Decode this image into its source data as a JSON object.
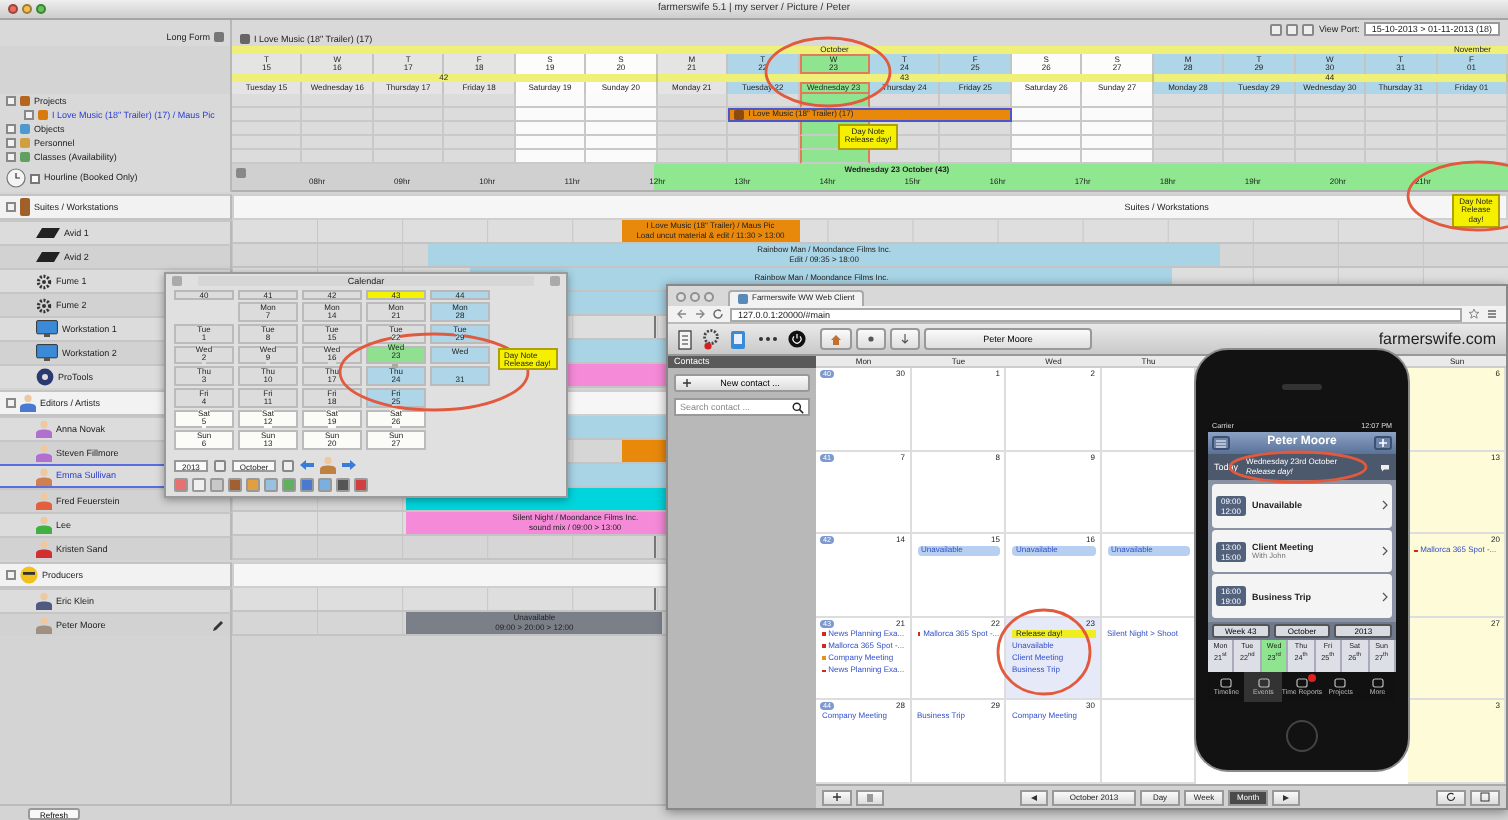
{
  "window": {
    "title": "farmerswife 5.1  |  my server / Picture / Peter"
  },
  "viewport": {
    "label": "View Port:",
    "value": "15-10-2013 > 01-11-2013 (18)"
  },
  "sidebar": {
    "long_form": "Long Form",
    "tree": [
      {
        "label": "Projects",
        "kind": "folder",
        "children": [
          {
            "label": "I Love Music (18\" Trailer) (17) / Maus Pic",
            "kind": "project"
          }
        ]
      },
      {
        "label": "Objects",
        "kind": "objects"
      },
      {
        "label": "Personnel",
        "kind": "personnel"
      },
      {
        "label": "Classes (Availability)",
        "kind": "classes"
      }
    ]
  },
  "timeline": {
    "project": "I Love Music (18\" Trailer) (17)",
    "project_bar": "I Love Music (18\" Trailer) (17)",
    "weeks": [
      {
        "label": "42",
        "days": [
          {
            "letter": "T",
            "num": "15",
            "name": "Tuesday 15",
            "kind": "weekday",
            "selected": false,
            "booked": false
          },
          {
            "letter": "W",
            "num": "16",
            "name": "Wednesday 16",
            "kind": "weekday",
            "selected": false,
            "booked": false
          },
          {
            "letter": "T",
            "num": "17",
            "name": "Thursday 17",
            "kind": "weekday",
            "selected": false,
            "booked": false
          },
          {
            "letter": "F",
            "num": "18",
            "name": "Friday 18",
            "kind": "weekday",
            "selected": false,
            "booked": false
          },
          {
            "letter": "S",
            "num": "19",
            "name": "Saturday 19",
            "kind": "weekend",
            "selected": false,
            "booked": false
          },
          {
            "letter": "S",
            "num": "20",
            "name": "Sunday 20",
            "kind": "weekend",
            "selected": false,
            "booked": false
          }
        ]
      },
      {
        "label": "43",
        "days": [
          {
            "letter": "M",
            "num": "21",
            "name": "Monday 21",
            "kind": "weekday",
            "selected": false,
            "booked": false
          },
          {
            "letter": "T",
            "num": "22",
            "name": "Tuesday 22",
            "kind": "current",
            "selected": false,
            "booked": true
          },
          {
            "letter": "W",
            "num": "23",
            "name": "Wednesday 23",
            "kind": "current",
            "selected": true,
            "booked": true,
            "month": "October",
            "note": {
              "title": "Day Note",
              "text": "Release day!"
            }
          },
          {
            "letter": "T",
            "num": "24",
            "name": "Thursday 24",
            "kind": "current",
            "selected": false,
            "booked": true
          },
          {
            "letter": "F",
            "num": "25",
            "name": "Friday 25",
            "kind": "current",
            "selected": false,
            "booked": true
          },
          {
            "letter": "S",
            "num": "26",
            "name": "Saturday 26",
            "kind": "weekend",
            "selected": false,
            "booked": false
          },
          {
            "letter": "S",
            "num": "27",
            "name": "Sunday 27",
            "kind": "weekend",
            "selected": false,
            "booked": false
          }
        ]
      },
      {
        "label": "44",
        "days": [
          {
            "letter": "M",
            "num": "28",
            "name": "Monday 28",
            "kind": "current",
            "selected": false,
            "booked": false
          },
          {
            "letter": "T",
            "num": "29",
            "name": "Tuesday 29",
            "kind": "current",
            "selected": false,
            "booked": false
          },
          {
            "letter": "W",
            "num": "30",
            "name": "Wednesday 30",
            "kind": "current",
            "selected": false,
            "booked": false
          },
          {
            "letter": "T",
            "num": "31",
            "name": "Thursday 31",
            "kind": "current",
            "selected": false,
            "booked": false
          },
          {
            "letter": "F",
            "num": "01",
            "name": "Friday 01",
            "kind": "current",
            "selected": false,
            "booked": false,
            "month": "November"
          }
        ]
      }
    ]
  },
  "hourline": {
    "label": "Hourline (Booked Only)",
    "checked": false,
    "day_title": "Wednesday 23 October (43)",
    "hours": [
      "08hr",
      "09hr",
      "10hr",
      "11hr",
      "12hr",
      "13hr",
      "14hr",
      "15hr",
      "16hr",
      "17hr",
      "18hr",
      "19hr",
      "20hr",
      "21hr"
    ]
  },
  "resources": [
    {
      "name": "Suites / Workstations",
      "kind": "room",
      "track_label": "Suites / Workstations",
      "note": {
        "title": "Day Note",
        "text": "Release day!"
      },
      "items": [
        {
          "name": "Avid 1",
          "kind": "device",
          "selected": false,
          "bookings": [
            {
              "title": "I Love Music (18\" Trailer) / Maus Pic",
              "detail": "Load uncut material & edit / 11:30 > 13:00",
              "color": "#e8890c"
            }
          ]
        },
        {
          "name": "Avid 2",
          "kind": "device",
          "selected": false,
          "bookings": [
            {
              "title": "Rainbow Man / Moondance Films Inc.",
              "detail": "Edit / 09:35 > 18:00",
              "color": "#a8d4e6"
            }
          ]
        },
        {
          "name": "Fume 1",
          "kind": "gear",
          "selected": false,
          "bookings": [
            {
              "title": "Rainbow Man / Moondance Films Inc.",
              "color": "#a8d4e6"
            }
          ]
        },
        {
          "name": "Fume 2",
          "kind": "gear",
          "selected": false,
          "bookings": [
            {
              "color": "#a8d4e6"
            }
          ]
        },
        {
          "name": "Workstation 1",
          "kind": "monitor",
          "selected": false
        },
        {
          "name": "Workstation 2",
          "kind": "monitor",
          "selected": false,
          "bookings": [
            {
              "color": "#a8d4e6"
            }
          ]
        },
        {
          "name": "ProTools",
          "kind": "disc",
          "selected": false,
          "bookings": [
            {
              "color": "#f58ad8"
            }
          ]
        }
      ]
    },
    {
      "name": "Editors / Artists",
      "kind": "person",
      "items": [
        {
          "name": "Anna Novak",
          "kind": "person",
          "color": "#b070d0",
          "selected": false,
          "bookings": [
            {
              "color": "#a8d4e6"
            }
          ]
        },
        {
          "name": "Steven Fillmore",
          "kind": "person",
          "color": "#b070d0",
          "selected": false,
          "bookings": [
            {
              "color": "#e8890c"
            }
          ]
        },
        {
          "name": "Emma Sullivan",
          "kind": "person",
          "color": "#d08050",
          "selected": true,
          "bookings": [
            {
              "color": "#a8d4e6"
            }
          ]
        },
        {
          "name": "Fred Feuerstein",
          "kind": "person",
          "color": "#e06040",
          "selected": false,
          "bookings": [
            {
              "color": "#00d4dc"
            }
          ]
        },
        {
          "name": "Lee",
          "kind": "person",
          "color": "#40b040",
          "selected": false,
          "bookings": [
            {
              "title": "Silent Night / Moondance Films Inc.",
              "detail": "sound mix / 09:00 > 13:00",
              "color": "#f58ad8"
            }
          ]
        },
        {
          "name": "Kristen Sand",
          "kind": "person",
          "color": "#d03030",
          "selected": false
        }
      ]
    },
    {
      "name": "Producers",
      "kind": "face",
      "items": [
        {
          "name": "Eric Klein",
          "kind": "person",
          "color": "#505a80",
          "selected": false
        },
        {
          "name": "Peter Moore",
          "kind": "person",
          "color": "#a09080",
          "selected": false,
          "edit_icon": true,
          "bookings": [
            {
              "title": "Unavailable",
              "detail": "09:00 > 20:00 > 12:00",
              "color": "#7a7f88"
            }
          ]
        }
      ]
    }
  ],
  "refresh": "Refresh",
  "calendar_dialog": {
    "title": "Calendar",
    "year": "2013",
    "month": "October",
    "weeks": [
      {
        "label": "40",
        "kind": "normal",
        "cells": [
          {
            "kind": "blank"
          },
          {
            "day": "Tue",
            "num": "1",
            "kind": "weekday"
          },
          {
            "day": "Wed",
            "num": "2",
            "kind": "weekday"
          },
          {
            "day": "Thu",
            "num": "3",
            "kind": "weekday"
          },
          {
            "day": "Fri",
            "num": "4",
            "kind": "weekday"
          },
          {
            "day": "Sat",
            "num": "5",
            "kind": "weekend"
          },
          {
            "day": "Sun",
            "num": "6",
            "kind": "weekend"
          }
        ]
      },
      {
        "label": "41",
        "kind": "normal",
        "cells": [
          {
            "day": "Mon",
            "num": "7",
            "kind": "weekday"
          },
          {
            "day": "Tue",
            "num": "8",
            "kind": "weekday"
          },
          {
            "day": "Wed",
            "num": "9",
            "kind": "weekday"
          },
          {
            "day": "Thu",
            "num": "10",
            "kind": "weekday"
          },
          {
            "day": "Fri",
            "num": "11",
            "kind": "weekday"
          },
          {
            "day": "Sat",
            "num": "12",
            "kind": "weekend"
          },
          {
            "day": "Sun",
            "num": "13",
            "kind": "weekend"
          }
        ]
      },
      {
        "label": "42",
        "kind": "normal",
        "cells": [
          {
            "day": "Mon",
            "num": "14",
            "kind": "weekday"
          },
          {
            "day": "Tue",
            "num": "15",
            "kind": "weekday"
          },
          {
            "day": "Wed",
            "num": "16",
            "kind": "weekday"
          },
          {
            "day": "Thu",
            "num": "17",
            "kind": "weekday"
          },
          {
            "day": "Fri",
            "num": "18",
            "kind": "weekday"
          },
          {
            "day": "Sat",
            "num": "19",
            "kind": "weekend"
          },
          {
            "day": "Sun",
            "num": "20",
            "kind": "weekend"
          }
        ]
      },
      {
        "label": "43",
        "kind": "marked",
        "cells": [
          {
            "day": "Mon",
            "num": "21",
            "kind": "weekday"
          },
          {
            "day": "Tue",
            "num": "22",
            "kind": "weekday"
          },
          {
            "day": "Wed",
            "num": "23",
            "kind": "selected",
            "flag": true
          },
          {
            "day": "Thu",
            "num": "24",
            "kind": "current"
          },
          {
            "day": "Fri",
            "num": "25",
            "kind": "current"
          },
          {
            "day": "Sat",
            "num": "26",
            "kind": "weekend"
          },
          {
            "day": "Sun",
            "num": "27",
            "kind": "weekend"
          }
        ]
      },
      {
        "label": "44",
        "kind": "current",
        "cells": [
          {
            "day": "Mon",
            "num": "28",
            "kind": "current"
          },
          {
            "day": "Tue",
            "num": "29",
            "kind": "current"
          },
          {
            "day": "Wed",
            "kind": "current",
            "note": {
              "title": "Day Note",
              "text": "Release day!"
            }
          },
          {
            "num": "31",
            "kind": "current"
          }
        ]
      }
    ]
  },
  "web_client": {
    "tab": "Farmerswife WW Web Client",
    "url": "127.0.0.1:20000/#main",
    "user": "Peter Moore",
    "brand": "farmerswife.com",
    "sidebar_title": "Contacts",
    "new_contact": "New contact ...",
    "search_placeholder": "Search contact ...",
    "weekdays": [
      "Mon",
      "Tue",
      "Wed",
      "Thu",
      "Sun"
    ],
    "weeks": [
      {
        "label": "40",
        "days": [
          {
            "num": "30",
            "weekend": false,
            "selected": false
          },
          {
            "num": "1",
            "weekend": false,
            "selected": false
          },
          {
            "num": "2",
            "weekend": false,
            "selected": false
          },
          {
            "weekend": false,
            "selected": false
          },
          {
            "num": "6",
            "weekend": true,
            "selected": false
          }
        ]
      },
      {
        "label": "41",
        "days": [
          {
            "num": "7",
            "weekend": false,
            "selected": false
          },
          {
            "num": "8",
            "weekend": false,
            "selected": false
          },
          {
            "num": "9",
            "weekend": false,
            "selected": false
          },
          {
            "weekend": false,
            "selected": false
          },
          {
            "num": "13",
            "weekend": true,
            "selected": false
          }
        ]
      },
      {
        "label": "42",
        "days": [
          {
            "num": "14",
            "weekend": false,
            "selected": false
          },
          {
            "num": "15",
            "weekend": false,
            "selected": false,
            "events": [
              {
                "title": "Unavailable",
                "kind": "bar"
              }
            ]
          },
          {
            "num": "16",
            "weekend": false,
            "selected": false,
            "events": [
              {
                "title": "Unavailable",
                "kind": "bar"
              }
            ]
          },
          {
            "weekend": false,
            "selected": false,
            "events": [
              {
                "title": "Unavailable",
                "kind": "bar"
              }
            ]
          },
          {
            "num": "20",
            "weekend": true,
            "selected": false,
            "events": [
              {
                "title": "Mallorca 365 Spot -...",
                "kind": "dot",
                "color": "#d02a20"
              }
            ]
          }
        ]
      },
      {
        "label": "43",
        "days": [
          {
            "num": "21",
            "weekend": false,
            "selected": false,
            "events": [
              {
                "title": "News Planning Exa...",
                "kind": "dot",
                "color": "#d02a20"
              },
              {
                "title": "Mallorca 365 Spot -...",
                "kind": "dot",
                "color": "#d02a20"
              },
              {
                "title": "Company Meeting",
                "kind": "dot",
                "color": "#e8901e"
              },
              {
                "title": "News Planning Exa...",
                "kind": "dot",
                "color": "#d02a20"
              }
            ]
          },
          {
            "num": "22",
            "weekend": false,
            "selected": false,
            "events": [
              {
                "title": "Mallorca 365 Spot -...",
                "kind": "dot",
                "color": "#d02a20"
              }
            ]
          },
          {
            "num": "23",
            "weekend": false,
            "selected": true,
            "events": [
              {
                "title": "Release day!",
                "kind": "highlight"
              },
              {
                "title": "Unavailable",
                "kind": "text"
              },
              {
                "title": "Client Meeting",
                "kind": "text"
              },
              {
                "title": "Business Trip",
                "kind": "text"
              }
            ]
          },
          {
            "weekend": false,
            "selected": false,
            "events": [
              {
                "title": "Silent Night > Shoot",
                "kind": "text"
              }
            ]
          },
          {
            "num": "27",
            "weekend": true,
            "selected": false
          }
        ]
      },
      {
        "label": "44",
        "days": [
          {
            "num": "28",
            "weekend": false,
            "selected": false,
            "events": [
              {
                "title": "Company Meeting",
                "kind": "text"
              }
            ]
          },
          {
            "num": "29",
            "weekend": false,
            "selected": false,
            "events": [
              {
                "title": "Business Trip",
                "kind": "text"
              }
            ]
          },
          {
            "num": "30",
            "weekend": false,
            "selected": false,
            "events": [
              {
                "title": "Company Meeting",
                "kind": "text"
              }
            ]
          },
          {
            "weekend": false,
            "selected": false
          },
          {
            "num": "3",
            "weekend": true,
            "selected": false
          }
        ]
      }
    ],
    "month_label": "October 2013",
    "views": [
      {
        "label": "Day",
        "selected": false
      },
      {
        "label": "Week",
        "selected": false
      },
      {
        "label": "Month",
        "selected": true
      }
    ]
  },
  "phone": {
    "carrier": "Carrier",
    "time": "12:07 PM",
    "title": "Peter Moore",
    "today": "Today",
    "date": "Wednesday 23rd October",
    "note": "Release day!",
    "events": [
      {
        "start": "09:00",
        "end": "12:00",
        "title": "Unavailable"
      },
      {
        "start": "13:00",
        "end": "15:00",
        "title": "Client Meeting",
        "subtitle": "With John"
      },
      {
        "start": "16:00",
        "end": "19:00",
        "title": "Business Trip"
      }
    ],
    "week": "Week 43",
    "month": "October",
    "year": "2013",
    "days": [
      {
        "name": "Mon",
        "num": "21$^{st}$",
        "selected": false
      },
      {
        "name": "Tue",
        "num": "22$^{nd}$",
        "selected": false
      },
      {
        "name": "Wed",
        "num": "23$^{rd}$",
        "selected": true
      },
      {
        "name": "Thu",
        "num": "24$^{th}$",
        "selected": false
      },
      {
        "name": "Fri",
        "num": "25$^{th}$",
        "selected": false
      },
      {
        "name": "Sat",
        "num": "26$^{th}$",
        "selected": false
      },
      {
        "name": "Sun",
        "num": "27$^{th}$",
        "selected": false
      }
    ],
    "tabs": [
      {
        "label": "Timeline",
        "selected": false,
        "badge": false
      },
      {
        "label": "Events",
        "selected": true,
        "badge": false
      },
      {
        "label": "Time Reports",
        "selected": false,
        "badge": true
      },
      {
        "label": "Projects",
        "selected": false,
        "badge": false
      },
      {
        "label": "More",
        "selected": false,
        "badge": false
      }
    ]
  }
}
